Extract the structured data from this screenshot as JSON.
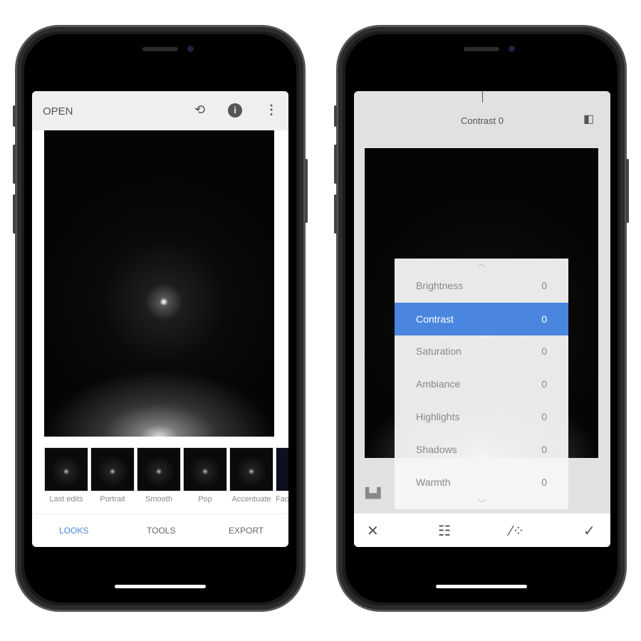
{
  "left": {
    "header": {
      "open_label": "OPEN",
      "icons": [
        "layers-undo-icon",
        "info-icon",
        "more-vert-icon"
      ]
    },
    "looks": [
      {
        "label": "Last edits"
      },
      {
        "label": "Portrait"
      },
      {
        "label": "Smooth"
      },
      {
        "label": "Pop"
      },
      {
        "label": "Accentuate"
      },
      {
        "label": "Fac"
      }
    ],
    "tabs": {
      "looks": "LOOKS",
      "tools": "TOOLS",
      "export": "EXPORT"
    },
    "accent": "#4a86e0"
  },
  "right": {
    "title": "Contrast 0",
    "adjustments": [
      {
        "name": "Brightness",
        "value": "0"
      },
      {
        "name": "Contrast",
        "value": "0",
        "selected": true
      },
      {
        "name": "Saturation",
        "value": "0"
      },
      {
        "name": "Ambiance",
        "value": "0"
      },
      {
        "name": "Highlights",
        "value": "0"
      },
      {
        "name": "Shadows",
        "value": "0"
      },
      {
        "name": "Warmth",
        "value": "0"
      }
    ],
    "bottom_icons": [
      "close-icon",
      "sliders-icon",
      "magic-wand-icon",
      "check-icon"
    ]
  }
}
